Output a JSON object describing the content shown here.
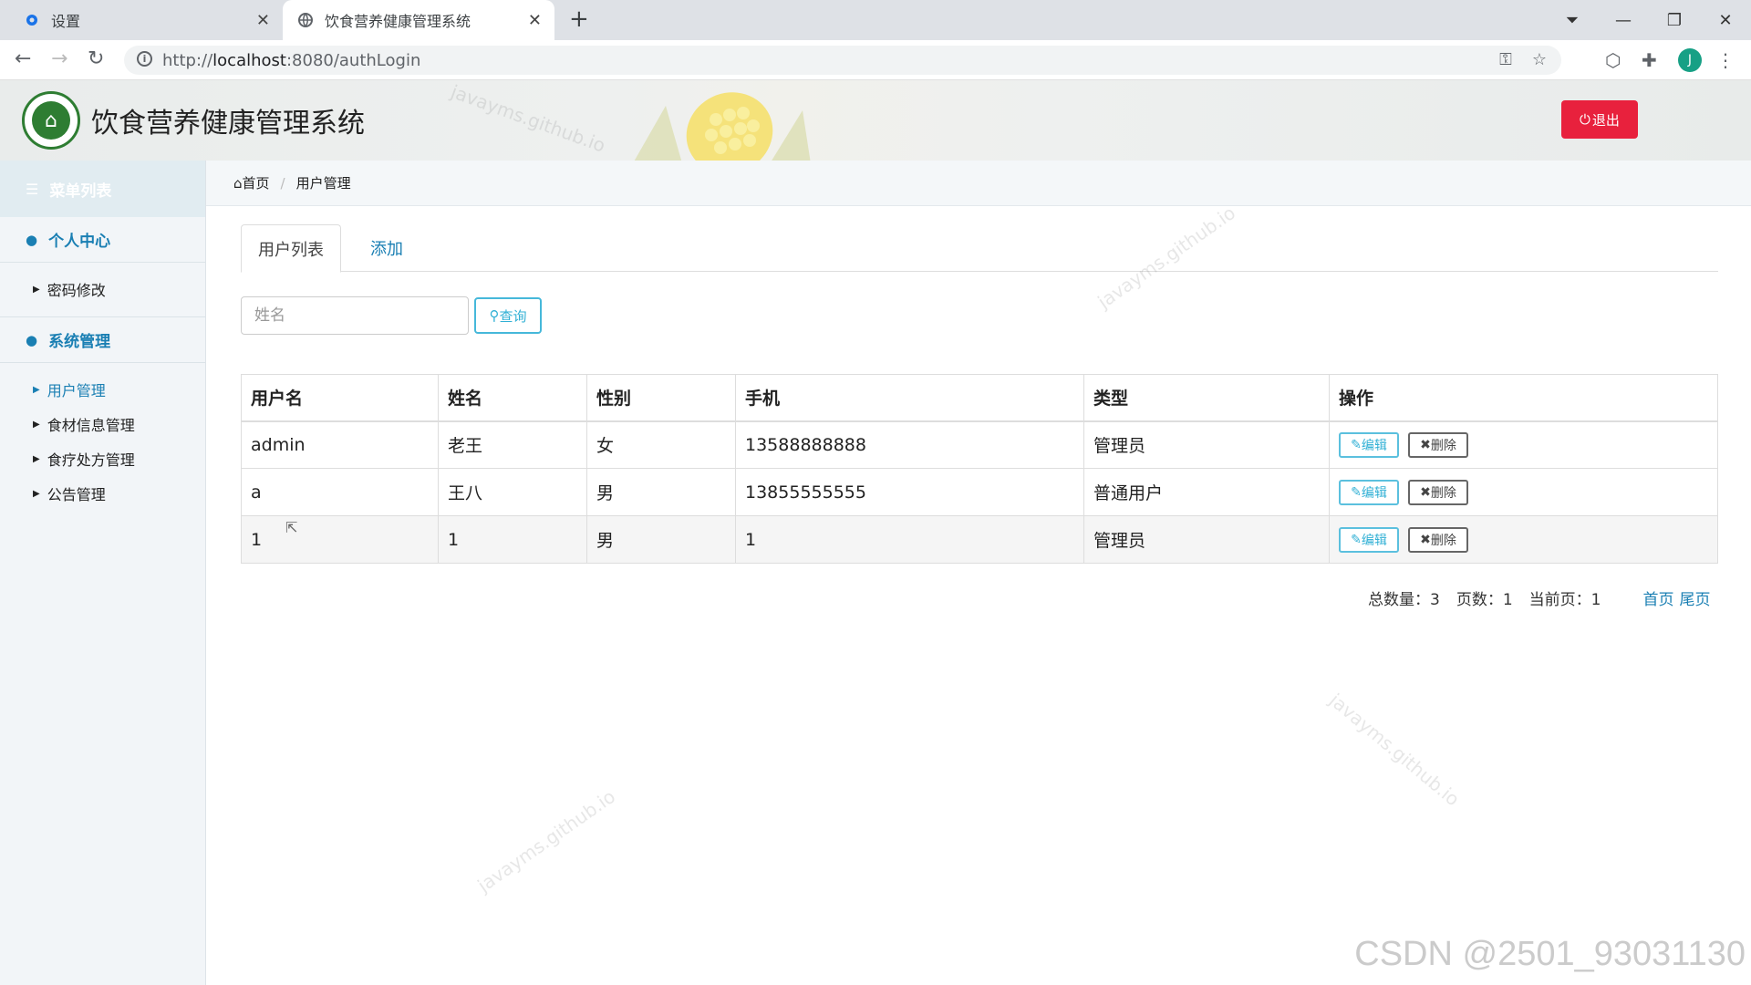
{
  "browser": {
    "tabs": [
      {
        "title": "设置",
        "icon": "gear-icon"
      },
      {
        "title": "饮食营养健康管理系统",
        "icon": "globe-icon"
      }
    ],
    "url_prefix": "http://",
    "url_host": "localhost",
    "url_rest": ":8080/authLogin",
    "avatar_letter": "J"
  },
  "header": {
    "title": "饮食营养健康管理系统",
    "logout_label": "退出"
  },
  "sidebar": {
    "menu_title": "菜单列表",
    "groups": [
      {
        "label": "个人中心",
        "items": [
          "密码修改"
        ]
      },
      {
        "label": "系统管理",
        "items": [
          "用户管理",
          "食材信息管理",
          "食疗处方管理",
          "公告管理"
        ]
      }
    ]
  },
  "breadcrumb": {
    "home": "首页",
    "current": "用户管理"
  },
  "tabs": {
    "list": "用户列表",
    "add": "添加"
  },
  "search": {
    "placeholder": "姓名",
    "button": "查询"
  },
  "table": {
    "headers": [
      "用户名",
      "姓名",
      "性别",
      "手机",
      "类型",
      "操作"
    ],
    "rows": [
      {
        "username": "admin",
        "name": "老王",
        "gender": "女",
        "phone": "13588888888",
        "type": "管理员"
      },
      {
        "username": "a",
        "name": "王八",
        "gender": "男",
        "phone": "13855555555",
        "type": "普通用户"
      },
      {
        "username": "1",
        "name": "1",
        "gender": "男",
        "phone": "1",
        "type": "管理员"
      }
    ],
    "edit_label": "编辑",
    "delete_label": "删除"
  },
  "pager": {
    "total": "总数量：3",
    "pages": "页数：1",
    "current": "当前页：1",
    "first": "首页",
    "last": "尾页"
  },
  "watermarks": {
    "site": "javayms.github.io",
    "csdn": "CSDN @2501_93031130"
  },
  "colors": {
    "accent": "#1a7fb3",
    "logout": "#e8213d",
    "info": "#5bc0de"
  }
}
